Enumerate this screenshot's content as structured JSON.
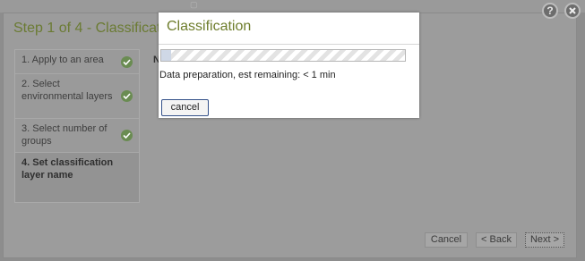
{
  "wizard": {
    "title": "Step 1 of 4 - Classification",
    "steps": [
      {
        "label": "1. Apply to an area",
        "done": true
      },
      {
        "label": "2. Select environmental layers",
        "done": true
      },
      {
        "label": "3. Select number of groups",
        "done": true
      },
      {
        "label": "4. Set classification layer name",
        "done": false
      }
    ],
    "content_label": "N",
    "buttons": {
      "cancel": "Cancel",
      "back": "< Back",
      "next": "Next >"
    }
  },
  "corner": {
    "help_icon": "help-icon",
    "close_icon": "close-icon",
    "help_glyph": "?"
  },
  "modal": {
    "title": "Classification",
    "progress": 0.04,
    "status": "Data preparation, est remaining: < 1 min",
    "cancel_label": "cancel"
  },
  "colors": {
    "title_green": "#6e7d2c",
    "check_green": "#6a8c52",
    "overlay": "#8d8d8d"
  }
}
